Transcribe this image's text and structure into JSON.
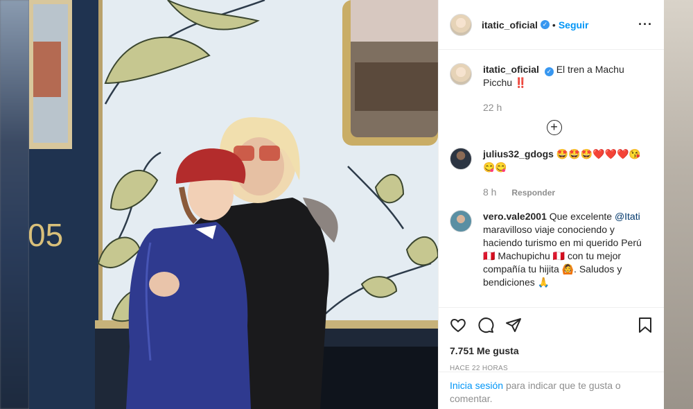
{
  "post": {
    "username": "itatic_oficial",
    "follow_label": "Seguir",
    "caption": "El tren a Machu Picchu ‼️",
    "caption_time": "22 h",
    "photo_number": "05"
  },
  "comments": [
    {
      "username": "julius32_gdogs",
      "text": "🤩🤩🤩❤️❤️❤️😘😋😋",
      "time": "8 h",
      "reply_label": "Responder"
    },
    {
      "username": "vero.vale2001",
      "text_before": "Que excelente",
      "mention": "@Itati",
      "text_after": "maravilloso viaje conociendo y haciendo turismo en mi querido Perú 🇵🇪 Machupichu 🇵🇪 con tu mejor compañía tu hijita 🙆. Saludos y bendiciones 🙏"
    }
  ],
  "likes": "7.751 Me gusta",
  "posted_ago": "HACE 22 HORAS",
  "login": {
    "link": "Inicia sesión",
    "text": "para indicar que te gusta o comentar."
  },
  "icons": [
    "more-options-icon",
    "verified-badge-icon",
    "add-replies-icon",
    "heart-icon",
    "comment-icon",
    "share-icon",
    "bookmark-icon"
  ],
  "colors": {
    "link_blue": "#0095f6",
    "verified_blue": "#3897f0",
    "text": "#262626",
    "muted": "#8e8e8e"
  }
}
